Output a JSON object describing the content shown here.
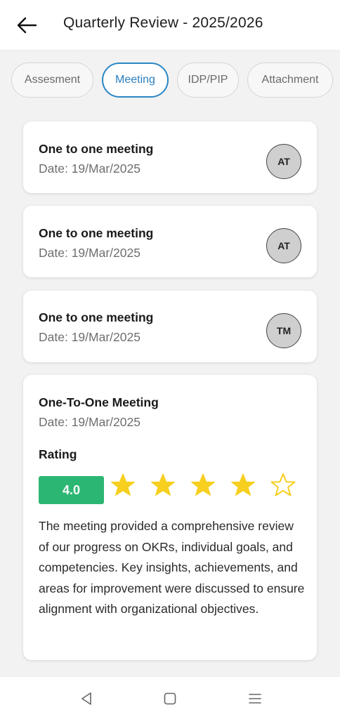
{
  "header": {
    "title": "Quarterly Review - 2025/2026"
  },
  "tabs": [
    {
      "label": "Assesment",
      "active": false
    },
    {
      "label": "Meeting",
      "active": true
    },
    {
      "label": "IDP/PIP",
      "active": false
    },
    {
      "label": "Attachment",
      "active": false
    }
  ],
  "meetings": [
    {
      "title": "One to one meeting",
      "date": "Date: 19/Mar/2025",
      "avatar": "AT"
    },
    {
      "title": "One to one meeting",
      "date": "Date: 19/Mar/2025",
      "avatar": "AT"
    },
    {
      "title": "One to one meeting",
      "date": "Date: 19/Mar/2025",
      "avatar": "TM"
    }
  ],
  "detail": {
    "title": "One-To-One Meeting",
    "date": "Date: 19/Mar/2025",
    "rating_label": "Rating",
    "rating_value": "4.0",
    "stars_filled": 4,
    "stars_total": 5,
    "description": "The meeting provided a comprehensive review of our progress on OKRs, individual goals, and competencies. Key insights, achievements, and areas for improvement were discussed to ensure alignment with organizational objectives."
  },
  "colors": {
    "accent": "#2a86c4",
    "rating_badge": "#2cb673",
    "star": "#f7cf1e"
  },
  "icons": {
    "back": "arrow-left-icon",
    "nav_back": "triangle-back-icon",
    "nav_home": "square-home-icon",
    "nav_menu": "menu-lines-icon"
  }
}
